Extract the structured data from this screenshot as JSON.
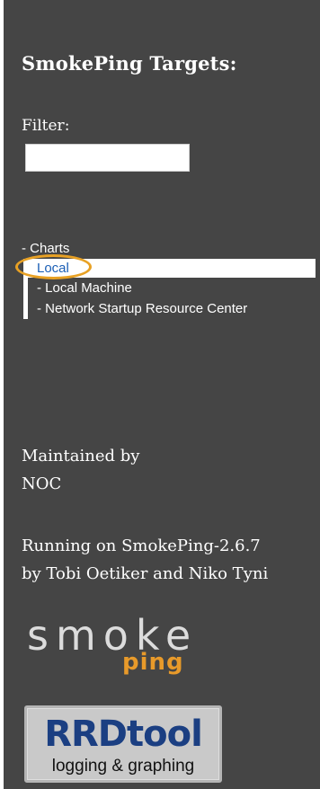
{
  "sidebar": {
    "title": "SmokePing Targets:",
    "filter": {
      "label": "Filter:",
      "value": "",
      "placeholder": ""
    },
    "tree": {
      "root": "- Charts",
      "selected": "Local",
      "children": [
        "- Local Machine",
        "- Network Startup Resource Center"
      ]
    },
    "maintained": {
      "line1": "Maintained by",
      "line2": "NOC"
    },
    "running": {
      "line1": "Running on SmokePing-2.6.7",
      "line2": "by Tobi Oetiker and Niko Tyni"
    },
    "logos": {
      "smoke": {
        "word": "smoke",
        "sub": "ping"
      },
      "rrd": {
        "word": "RRDtool",
        "sub": "logging & graphing"
      }
    }
  },
  "colors": {
    "panel": "#454545",
    "selected_text": "#1b5fb6",
    "highlight_ring": "#e8a124",
    "ping": "#e89a2a",
    "rrd_blue": "#1b3f82"
  }
}
